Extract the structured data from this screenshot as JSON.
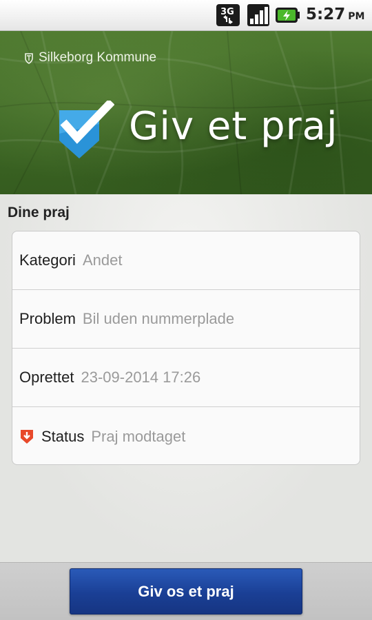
{
  "status_bar": {
    "network_type": "3G",
    "icons": [
      "3g-data-icon",
      "signal-strength-icon",
      "battery-charging-icon"
    ],
    "time": "5:27",
    "ampm": "PM"
  },
  "header": {
    "municipality": "Silkeborg Kommune",
    "app_title": "Giv et praj",
    "logo_icon": "checkmark-shield-icon",
    "background_color": "#3e6825"
  },
  "main": {
    "section_title": "Dine praj",
    "rows": [
      {
        "label": "Kategori",
        "value": "Andet"
      },
      {
        "label": "Problem",
        "value": "Bil uden nummerplade"
      },
      {
        "label": "Oprettet",
        "value": "23-09-2014 17:26"
      },
      {
        "label": "Status",
        "value": "Praj modtaget",
        "icon": "download-status-icon"
      }
    ]
  },
  "footer": {
    "button_label": "Giv os et praj",
    "button_color": "#1a3f95"
  }
}
